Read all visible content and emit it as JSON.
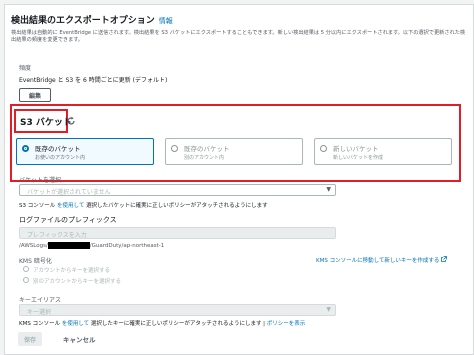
{
  "header": {
    "title": "検出結果のエクスポートオプション",
    "info_link": "情報",
    "description": "検出結果は自動的に EventBridge に送信されます。検出結果を S3 バケットにエクスポートすることもできます。新しい検出結果は 5 分以内にエクスポートされます。以下の選択で更新された検出結果の頻度を変更できます。"
  },
  "frequency": {
    "label": "頻度",
    "value": "EventBridge と S3 を 6 時間ごとに更新 (デフォルト)",
    "edit_label": "編集"
  },
  "s3": {
    "title": "S3 バケット",
    "options": [
      {
        "title": "既存のバケット",
        "subtitle": "お使いのアカウント内",
        "selected": true,
        "disabled": false
      },
      {
        "title": "既存のバケット",
        "subtitle": "別のアカウント内",
        "selected": false,
        "disabled": true
      },
      {
        "title": "新しいバケット",
        "subtitle": "新しいバケットを作成",
        "selected": false,
        "disabled": true
      }
    ],
    "select_label": "バケットを選択",
    "select_placeholder": "バケットが選択されていません",
    "console_hint_prefix": "S3 コンソール",
    "console_hint_link": "を使用して",
    "console_hint_suffix": " 選択したバケットに確実に正しいポリシーがアタッチされるようにします"
  },
  "log_prefix": {
    "label": "ログファイルのプレフィックス",
    "placeholder": "プレフィックスを入力",
    "path_before": "/AWSLogs/",
    "path_after": "/GuardDuty/ap-northeast-1"
  },
  "kms": {
    "label": "KMS 暗号化",
    "options": [
      "アカウントからキーを選択する",
      "別のアカウントからキーを選択する"
    ],
    "console_link": "KMS コンソールに移動して新しいキーを作成する",
    "alias_label": "キーエイリアス",
    "alias_placeholder": "キー選択",
    "hint_prefix": "KMS コンソール",
    "hint_link": "を使用して",
    "hint_middle": " 選択したキーに確実に正しいポリシーがアタッチされるようにします | ",
    "hint_policy_link": "ポリシーを表示"
  },
  "footer": {
    "save_label": "保存",
    "cancel_label": "キャンセル"
  },
  "colors": {
    "accent": "#0073bb",
    "highlight": "#e01e25"
  },
  "icons": {
    "refresh": "refresh-icon",
    "caret": "caret-down-icon",
    "external": "external-link-icon"
  }
}
